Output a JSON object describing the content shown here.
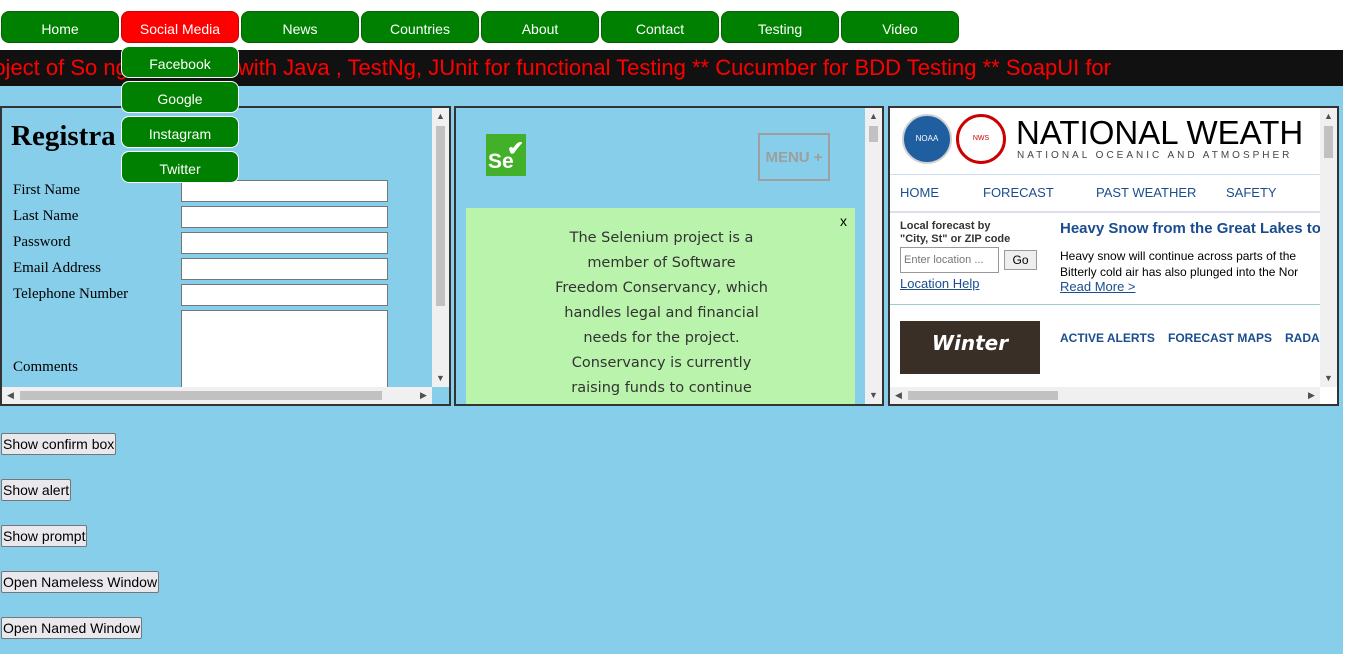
{
  "nav": {
    "items": [
      "Home",
      "Social Media",
      "News",
      "Countries",
      "About",
      "Contact",
      "Testing",
      "Video"
    ],
    "active_index": 1,
    "dropdown": [
      "Facebook",
      "Google",
      "Instagram",
      "Twitter"
    ]
  },
  "marquee": {
    "text": "roject of So                    ng. Selenium with Java , TestNg, JUnit for functional Testing ** Cucumber for BDD Testing ** SoapUI for"
  },
  "registration": {
    "title": "Registra           m",
    "labels": [
      "First Name",
      "Last Name",
      "Password",
      "Email Address",
      "Telephone Number",
      "Comments"
    ]
  },
  "selenium": {
    "logo_text": "Se",
    "menu_label": "MENU +",
    "close_label": "x",
    "body": "The Selenium project is a member of Software Freedom Conservancy, which handles legal and financial needs for the project. Conservancy is currently raising funds to continue"
  },
  "nws": {
    "noaa_logo": "NOAA",
    "nws_logo": "NATIONAL WEATHER SERVICE",
    "title": "NATIONAL WEATH",
    "subtitle": "NATIONAL OCEANIC AND ATMOSPHER",
    "nav": [
      "HOME",
      "FORECAST",
      "PAST WEATHER",
      "SAFETY"
    ],
    "local_label_1": "Local forecast by",
    "local_label_2": "\"City, St\" or ZIP code",
    "location_placeholder": "Enter location ...",
    "go_label": "Go",
    "location_help": "Location Help",
    "headline": "Heavy Snow from the Great Lakes to",
    "story_1": "Heavy snow will continue across parts of the",
    "story_2": "Bitterly cold air has also plunged into the Nor",
    "read_more": "Read More >",
    "winter_safety": "Winter Safety",
    "links": [
      "ACTIVE ALERTS",
      "FORECAST MAPS",
      "RADAI"
    ]
  },
  "buttons": [
    "Show confirm box",
    "Show alert",
    "Show prompt",
    "Open Nameless Window",
    "Open Named Window"
  ],
  "colors": {
    "page_bg": "#87ceeb",
    "nav_green": "#008000",
    "nav_active": "#ff0000",
    "marquee_text": "#ff0000"
  }
}
